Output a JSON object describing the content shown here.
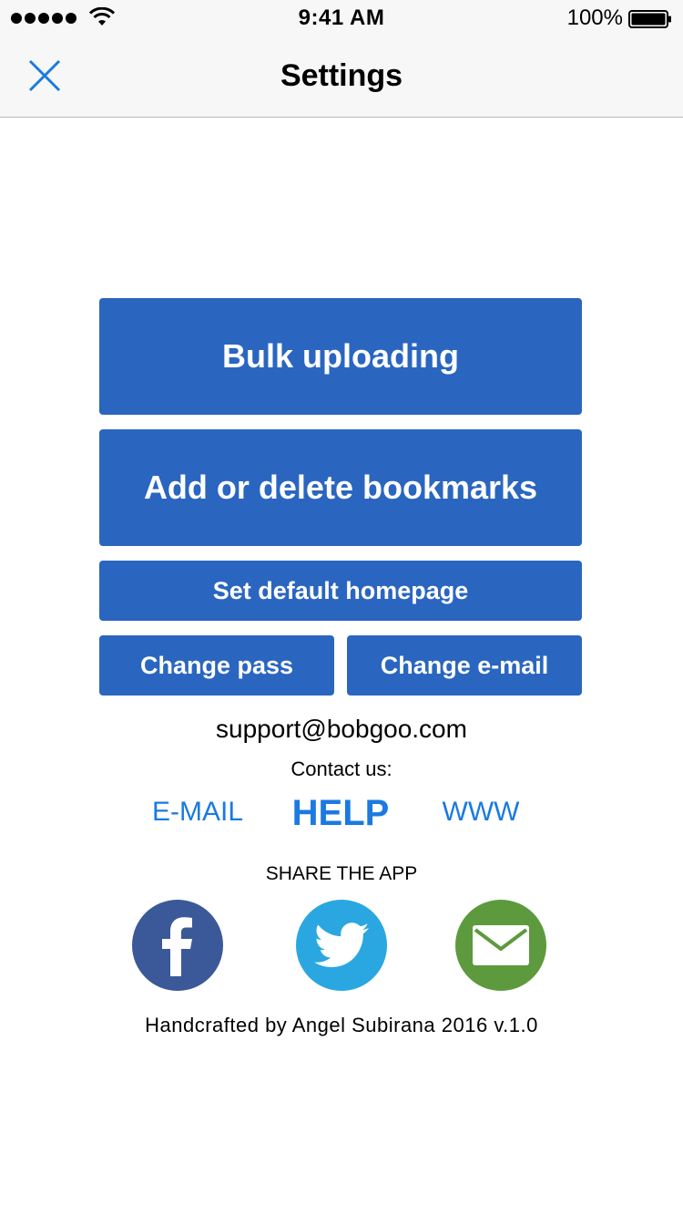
{
  "status_bar": {
    "time": "9:41 AM",
    "battery_percent": "100%"
  },
  "nav": {
    "title": "Settings",
    "close_icon": "close-icon"
  },
  "buttons": {
    "bulk_uploading": "Bulk uploading",
    "bookmarks": "Add or delete bookmarks",
    "default_homepage": "Set default homepage",
    "change_pass": "Change pass",
    "change_email": "Change e-mail"
  },
  "support": {
    "email": "support@bobgoo.com",
    "contact_label": "Contact us:"
  },
  "contact_links": {
    "email": "E-MAIL",
    "help": "HELP",
    "www": "WWW"
  },
  "share": {
    "label": "SHARE THE APP",
    "icons": [
      "facebook-icon",
      "twitter-icon",
      "mail-icon"
    ]
  },
  "footer": {
    "credit": "Handcrafted by Angel Subirana 2016 v.1.0"
  },
  "colors": {
    "button_blue": "#2a66c0",
    "link_blue": "#1a7ae0",
    "facebook": "#3b5998",
    "twitter": "#2aa7e0",
    "mail": "#5d9a3d"
  }
}
